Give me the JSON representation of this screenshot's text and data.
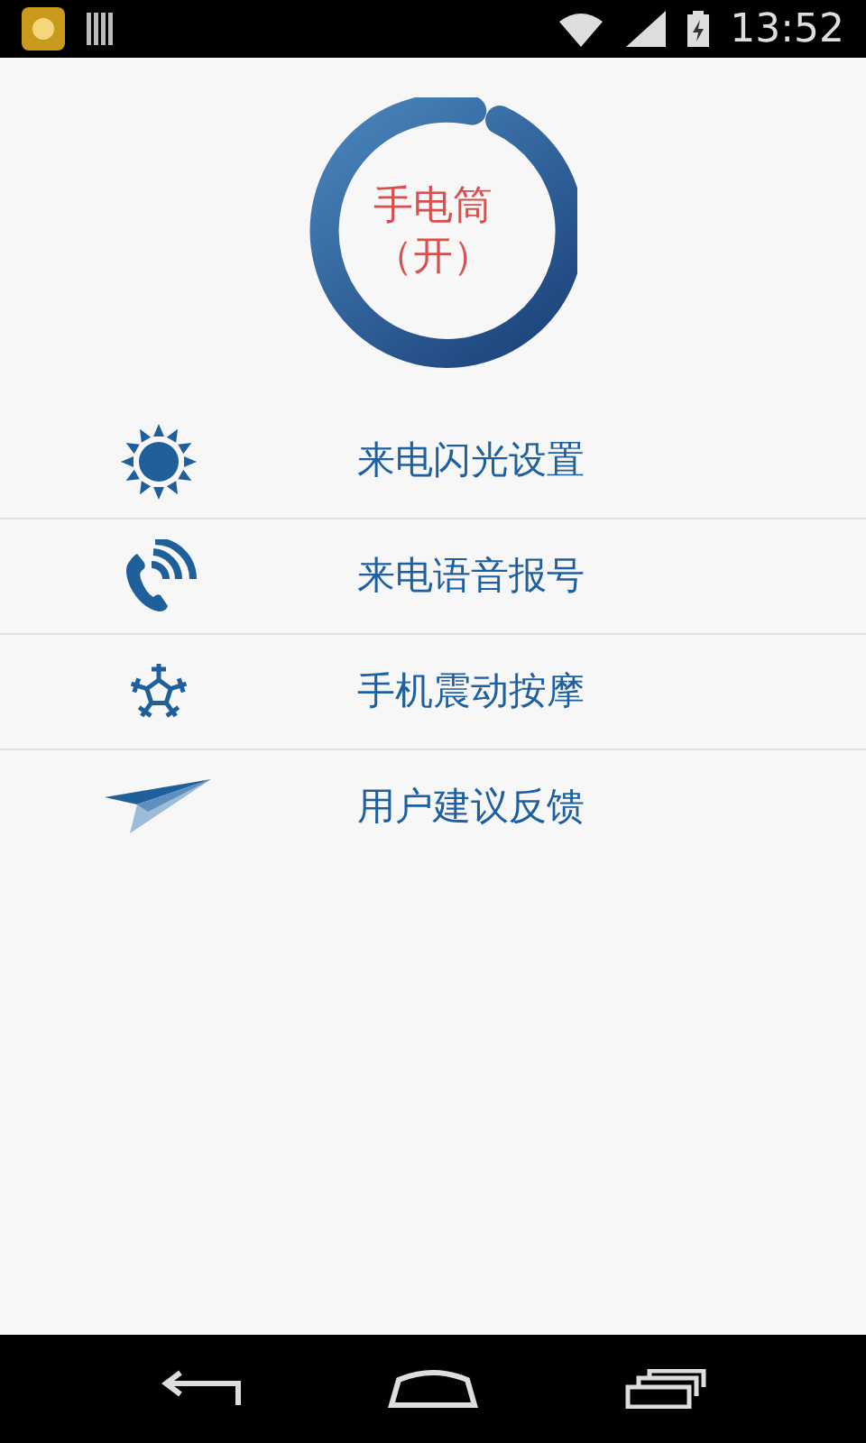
{
  "status_bar": {
    "time": "13:52"
  },
  "flashlight": {
    "title": "手电筒",
    "state": "（开）"
  },
  "menu": [
    {
      "kind": "sun",
      "label": "来电闪光设置"
    },
    {
      "kind": "phone",
      "label": "来电语音报号"
    },
    {
      "kind": "snowflake",
      "label": "手机震动按摩"
    },
    {
      "kind": "plane",
      "label": "用户建议反馈"
    }
  ]
}
